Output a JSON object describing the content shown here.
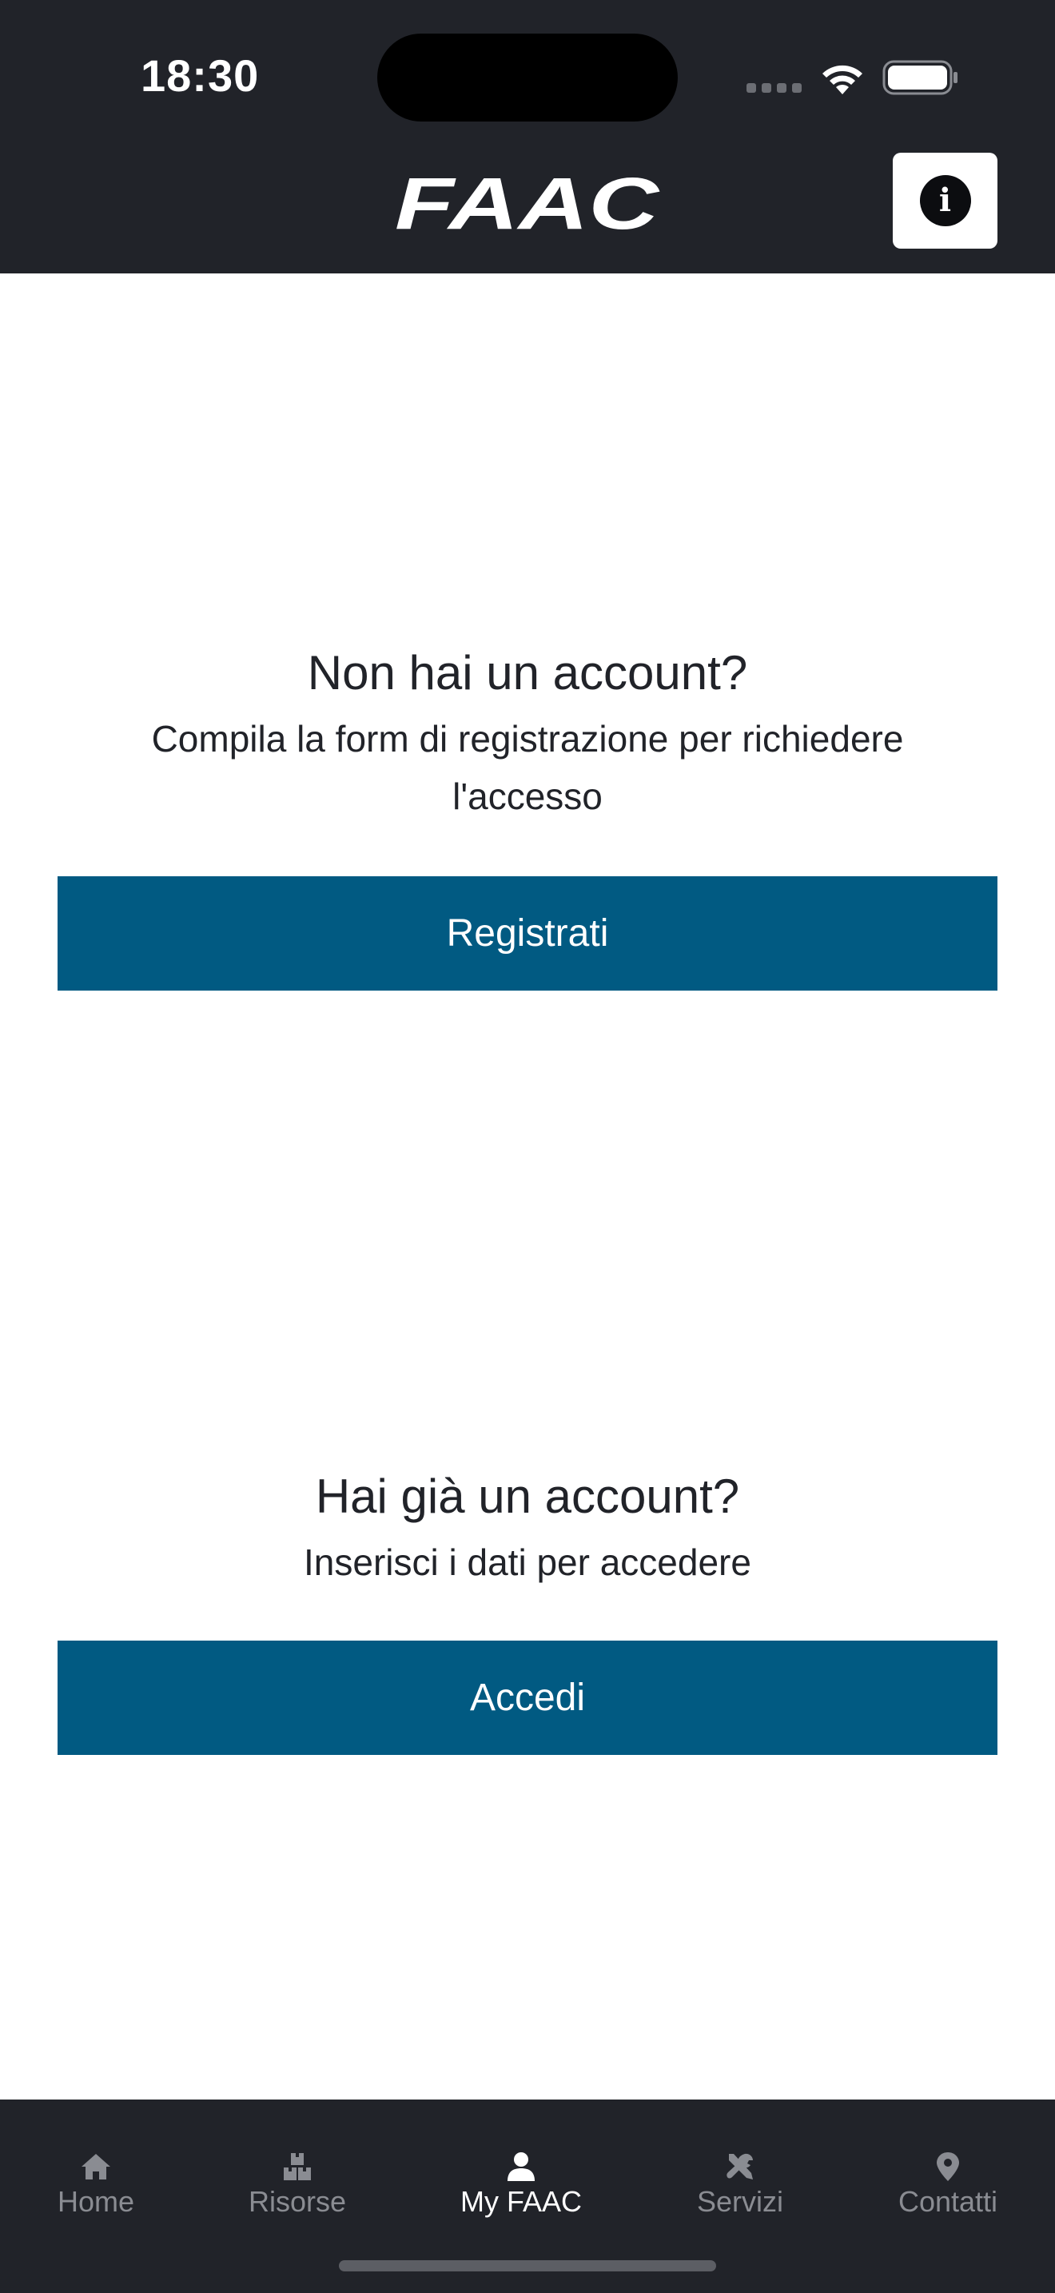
{
  "status_bar": {
    "time": "18:30"
  },
  "app_bar": {
    "logo_text": "FAAC",
    "info_icon": "info-icon"
  },
  "register_section": {
    "title": "Non hai un account?",
    "description": "Compila la form di registrazione per richiedere l'accesso",
    "button_label": "Registrati"
  },
  "login_section": {
    "title": "Hai già un account?",
    "description": "Inserisci i dati per accedere",
    "button_label": "Accedi"
  },
  "tabbar": {
    "active": "My FAAC",
    "items": [
      {
        "label": "Home",
        "icon": "home-icon"
      },
      {
        "label": "Risorse",
        "icon": "boxes-icon"
      },
      {
        "label": "My FAAC",
        "icon": "user-icon"
      },
      {
        "label": "Servizi",
        "icon": "tools-icon"
      },
      {
        "label": "Contatti",
        "icon": "map-pin-icon"
      }
    ]
  },
  "colors": {
    "header_bg": "#212329",
    "button_bg": "#015a82",
    "tab_inactive": "#8a8c92",
    "tab_active": "#ffffff"
  }
}
